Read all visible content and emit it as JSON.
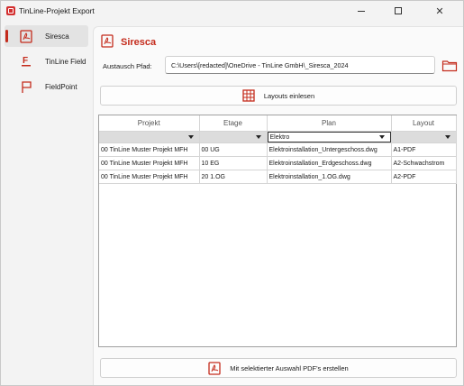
{
  "window": {
    "title": "TinLine-Projekt Export",
    "minimize_icon": "minimize-icon",
    "maximize_icon": "maximize-icon",
    "close_icon": "close-icon",
    "close_glyph": "✕"
  },
  "sidebar": {
    "items": [
      {
        "label": "Siresca",
        "icon": "pdf-icon",
        "active": true
      },
      {
        "label": "TinLine Field",
        "icon": "field-logo-icon",
        "active": false
      },
      {
        "label": "FieldPoint",
        "icon": "flag-icon",
        "active": false
      }
    ]
  },
  "header": {
    "title": "Siresca",
    "icon": "pdf-icon"
  },
  "path": {
    "label": "Austausch Pfad:",
    "value": "C:\\Users\\[redacted]\\OneDrive - TinLine GmbH\\_Siresca_2024",
    "browse_icon": "folder-icon"
  },
  "buttons": {
    "read_layouts": "Layouts einlesen",
    "create_pdfs": "Mit selektierter Auswahl PDF's erstellen"
  },
  "grid": {
    "columns": [
      "Projekt",
      "Etage",
      "Plan",
      "Layout"
    ],
    "filters": [
      "",
      "",
      "Elektro",
      ""
    ],
    "rows": [
      [
        "00 TinLine Muster Projekt MFH",
        "00 UG",
        "Elektroinstallation_Untergeschoss.dwg",
        "A1-PDF"
      ],
      [
        "00 TinLine Muster Projekt MFH",
        "10 EG",
        "Elektroinstallation_Erdgeschoss.dwg",
        "A2-Schwachstrom"
      ],
      [
        "00 TinLine Muster Projekt MFH",
        "20 1.OG",
        "Elektroinstallation_1.OG.dwg",
        "A2-PDF"
      ]
    ]
  },
  "colors": {
    "accent": "#c42b1c",
    "app_icon": "#d32f2f"
  }
}
